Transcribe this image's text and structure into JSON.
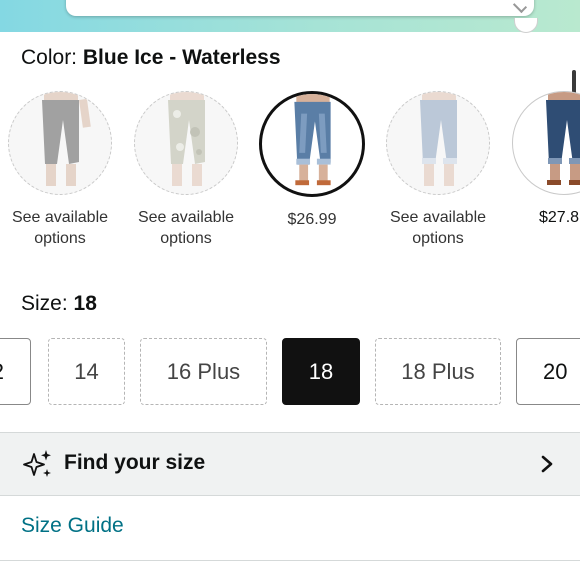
{
  "color": {
    "label": "Color:",
    "value": "Blue Ice - Waterless"
  },
  "swatches": [
    {
      "caption": "See available\noptions",
      "state": "unavailable",
      "color": "#5b5b5b"
    },
    {
      "caption": "See available\noptions",
      "state": "unavailable",
      "color": "#b7b9a4"
    },
    {
      "caption": "$26.99",
      "state": "selected",
      "color": "#5a7ea6"
    },
    {
      "caption": "See available\noptions",
      "state": "unavailable",
      "color": "#8aa3c0"
    },
    {
      "caption": "$27.8",
      "state": "available",
      "color": "#2f4d74"
    }
  ],
  "size": {
    "label": "Size:",
    "value": "18",
    "options": [
      {
        "label": "2",
        "state": "available"
      },
      {
        "label": "14",
        "state": "unavailable"
      },
      {
        "label": "16 Plus",
        "state": "unavailable"
      },
      {
        "label": "18",
        "state": "selected"
      },
      {
        "label": "18 Plus",
        "state": "unavailable"
      },
      {
        "label": "20",
        "state": "available"
      }
    ]
  },
  "find_size": {
    "label": "Find your size",
    "icon": "sparkle-icon",
    "chevron": "chevron-right-icon"
  },
  "size_guide": {
    "label": "Size Guide",
    "link_color": "#007185"
  }
}
